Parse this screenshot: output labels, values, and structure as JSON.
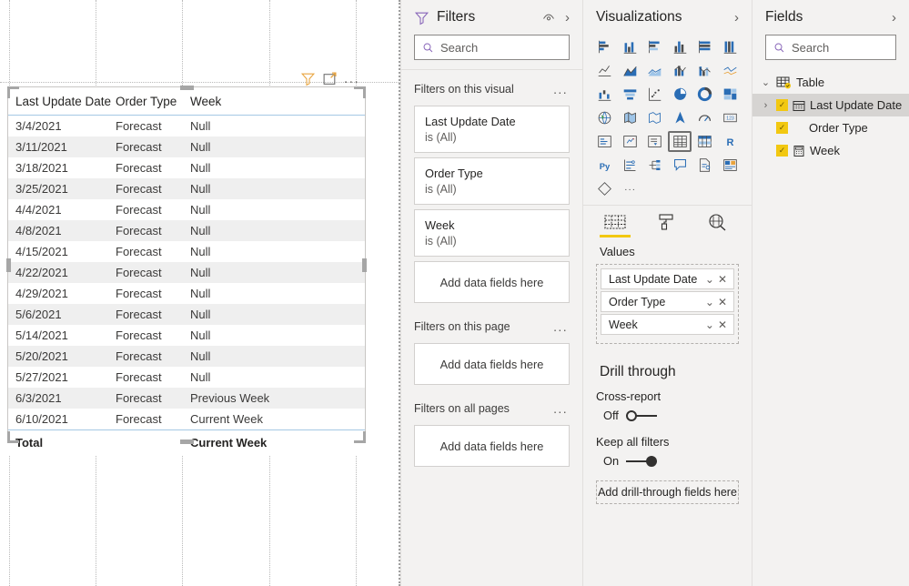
{
  "canvas": {
    "visual_header": {
      "filter_icon": "filter-icon",
      "focus_icon": "focus-mode-icon",
      "more_options": "..."
    },
    "table": {
      "columns": [
        "Last Update Date",
        "Order Type",
        "Week"
      ],
      "rows": [
        [
          "3/4/2021",
          "Forecast",
          "Null"
        ],
        [
          "3/11/2021",
          "Forecast",
          "Null"
        ],
        [
          "3/18/2021",
          "Forecast",
          "Null"
        ],
        [
          "3/25/2021",
          "Forecast",
          "Null"
        ],
        [
          "4/4/2021",
          "Forecast",
          "Null"
        ],
        [
          "4/8/2021",
          "Forecast",
          "Null"
        ],
        [
          "4/15/2021",
          "Forecast",
          "Null"
        ],
        [
          "4/22/2021",
          "Forecast",
          "Null"
        ],
        [
          "4/29/2021",
          "Forecast",
          "Null"
        ],
        [
          "5/6/2021",
          "Forecast",
          "Null"
        ],
        [
          "5/14/2021",
          "Forecast",
          "Null"
        ],
        [
          "5/20/2021",
          "Forecast",
          "Null"
        ],
        [
          "5/27/2021",
          "Forecast",
          "Null"
        ],
        [
          "6/3/2021",
          "Forecast",
          "Previous Week"
        ],
        [
          "6/10/2021",
          "Forecast",
          "Current Week"
        ]
      ],
      "total_row": [
        "Total",
        "",
        "Current Week"
      ]
    }
  },
  "filters": {
    "title": "Filters",
    "funnel_icon": "filter-funnel-icon",
    "hide_icon": "eye-hide-icon",
    "collapse_icon": "chevron-right-icon",
    "search_placeholder": "Search",
    "groups": [
      {
        "label": "Filters on this visual",
        "cards": [
          {
            "name": "Last Update Date",
            "value": "is (All)"
          },
          {
            "name": "Order Type",
            "value": "is (All)"
          },
          {
            "name": "Week",
            "value": "is (All)"
          }
        ],
        "dropzone": "Add data fields here"
      },
      {
        "label": "Filters on this page",
        "cards": [],
        "dropzone": "Add data fields here"
      },
      {
        "label": "Filters on all pages",
        "cards": [],
        "dropzone": "Add data fields here"
      }
    ],
    "more_label": "..."
  },
  "visualizations": {
    "title": "Visualizations",
    "collapse_icon": "chevron-right-icon",
    "icons": [
      "stacked-bar-chart",
      "stacked-column-chart",
      "clustered-bar-chart",
      "clustered-column-chart",
      "100-stacked-bar-chart",
      "100-stacked-column-chart",
      "line-chart",
      "area-chart",
      "stacked-area-chart",
      "line-and-stacked-column-chart",
      "line-and-clustered-column-chart",
      "ribbon-chart",
      "waterfall-chart",
      "funnel-chart",
      "scatter-chart",
      "pie-chart",
      "donut-chart",
      "treemap",
      "map",
      "filled-map",
      "shape-map",
      "azure-map",
      "gauge-chart",
      "card",
      "multi-row-card",
      "kpi",
      "slicer",
      "table",
      "matrix",
      "r-script-visual",
      "python-visual",
      "key-influencers",
      "decomposition-tree",
      "qna-visual",
      "smart-narrative",
      "paginated-report",
      "power-apps-visual",
      "get-more-visuals"
    ],
    "selected_icon": "table",
    "tabs": [
      {
        "name": "fields-tab",
        "icon": "fields-grid-icon",
        "active": true
      },
      {
        "name": "format-tab",
        "icon": "paint-roller-icon",
        "active": false
      },
      {
        "name": "analytics-tab",
        "icon": "magnifier-analytics-icon",
        "active": false
      }
    ],
    "values_label": "Values",
    "value_wells": [
      "Last Update Date",
      "Order Type",
      "Week"
    ],
    "well_chevron": "chevron-down-icon",
    "well_remove": "remove-icon",
    "drill_through": {
      "title": "Drill through",
      "cross_report_label": "Cross-report",
      "cross_report_state": "Off",
      "keep_all_filters_label": "Keep all filters",
      "keep_all_filters_state": "On",
      "dropzone": "Add drill-through fields here"
    }
  },
  "fields": {
    "title": "Fields",
    "collapse_icon": "chevron-right-icon",
    "search_placeholder": "Search",
    "tree": {
      "table_name": "Table",
      "items": [
        {
          "label": "Last Update Date",
          "icon": "calendar-icon",
          "checked": true,
          "expandable": true,
          "selected": true
        },
        {
          "label": "Order Type",
          "icon": "none",
          "checked": true,
          "expandable": false,
          "selected": false
        },
        {
          "label": "Week",
          "icon": "calculator-icon",
          "checked": true,
          "expandable": false,
          "selected": false
        }
      ]
    }
  }
}
